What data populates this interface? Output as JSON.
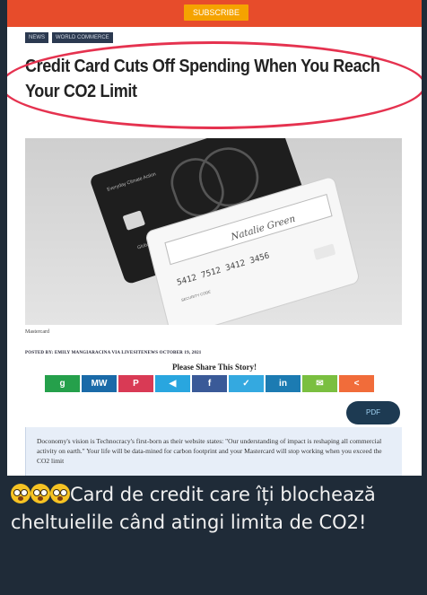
{
  "header": {
    "subscribe_label": "SUBSCRIBE",
    "nav": [
      "NEWS",
      "WORLD COMMERCE"
    ]
  },
  "article": {
    "title": "Credit Card Cuts Off Spending When You Reach Your CO2 Limit",
    "image_caption": "Mastercard",
    "posted_by": "POSTED BY: EMILY MANGIARACINA VIA LIVESITENEWS   OCTOBER 19, 2021",
    "share_prompt": "Please Share This Story!",
    "quote": "Doconomy's vision is Technocracy's first-born as their website states: \"Our understanding of impact is reshaping all commercial activity on earth.\" Your life will be data-mined for carbon footprint and your Mastercard will stop working when you exceed the CO2 limit"
  },
  "card_text": {
    "front_brand": "Everyday Climate Action",
    "front_label": "Global Climate Action",
    "back_number": "5412 7512 3412 3456",
    "back_signature": "Natalie Green",
    "back_labels": "SECURITY CODE"
  },
  "share_buttons": [
    {
      "name": "gab",
      "label": "g",
      "color": "#25a04b"
    },
    {
      "name": "mewe",
      "label": "MW",
      "color": "#1a6aa8"
    },
    {
      "name": "parler",
      "label": "P",
      "color": "#d93a55"
    },
    {
      "name": "telegram",
      "label": "◀",
      "color": "#29a6df"
    },
    {
      "name": "facebook",
      "label": "f",
      "color": "#3a5a98"
    },
    {
      "name": "twitter",
      "label": "✓",
      "color": "#34a9e0"
    },
    {
      "name": "linkedin",
      "label": "in",
      "color": "#1c7bb2"
    },
    {
      "name": "email",
      "label": "✉",
      "color": "#7abf40"
    },
    {
      "name": "share",
      "label": "<",
      "color": "#f16c3a"
    }
  ],
  "pill_label": "PDF",
  "message": {
    "emoji": [
      "flushed-face-icon",
      "flushed-face-icon",
      "flushed-face-icon"
    ],
    "text": "Card de credit care îți blochează cheltuielile când atingi limita de CO2!"
  }
}
